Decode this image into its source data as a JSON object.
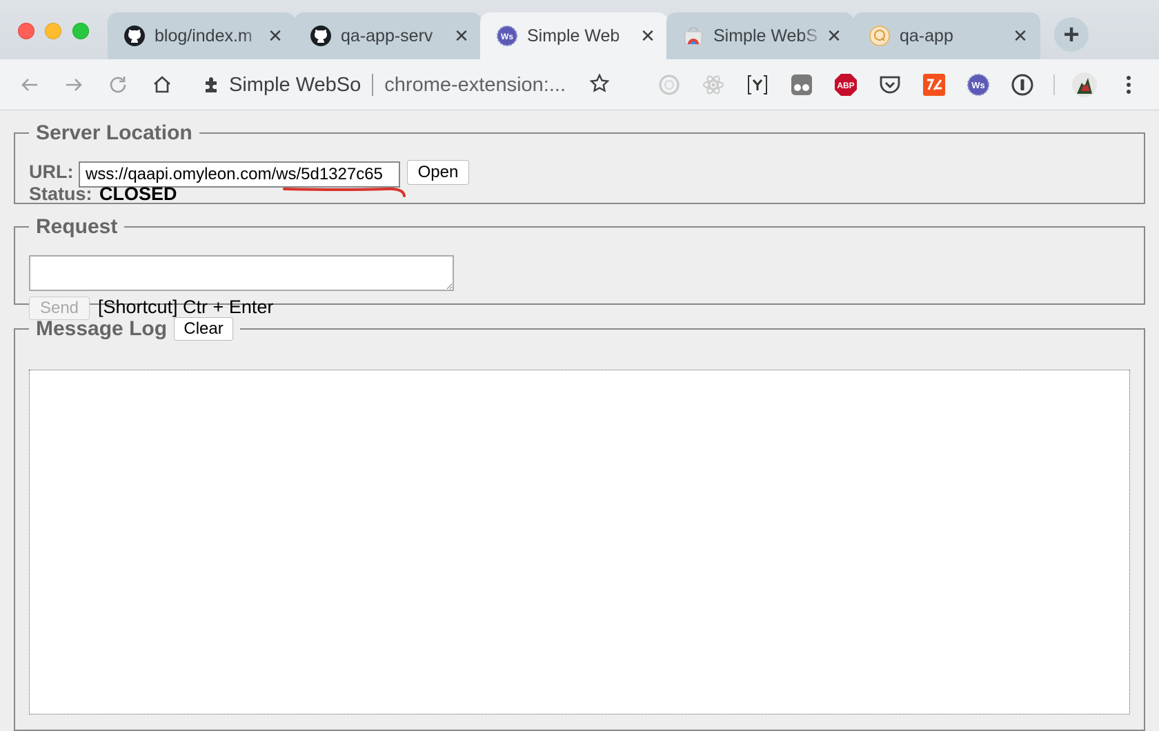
{
  "tabs": [
    {
      "title": "blog/index.m",
      "favicon": "github-icon",
      "active": false
    },
    {
      "title": "qa-app-serv",
      "favicon": "github-icon",
      "active": false
    },
    {
      "title": "Simple Web",
      "favicon": "websocket-icon",
      "active": true
    },
    {
      "title": "Simple WebS",
      "favicon": "chrome-webstore-icon",
      "active": false
    },
    {
      "title": "qa-app",
      "favicon": "qa-app-icon",
      "active": false
    }
  ],
  "toolbar": {
    "site_name": "Simple WebSo",
    "url": "chrome-extension:..."
  },
  "server_location": {
    "legend": "Server Location",
    "url_label": "URL:",
    "url_value": "wss://qaapi.omyleon.com/ws/5d1327c65",
    "open_label": "Open",
    "status_label": "Status:",
    "status_value": "CLOSED"
  },
  "request": {
    "legend": "Request",
    "send_label": "Send",
    "shortcut_text": "[Shortcut] Ctr + Enter"
  },
  "message_log": {
    "legend": "Message Log",
    "clear_label": "Clear"
  },
  "extensions": [
    "extension-icon-1",
    "react-devtools-icon",
    "extension-icon-3",
    "tampermonkey-icon",
    "adblock-plus-icon",
    "pocket-icon",
    "extension-icon-7",
    "websocket-extension-icon",
    "1password-icon"
  ],
  "colors": {
    "annotation_underline": "#d9342b"
  }
}
